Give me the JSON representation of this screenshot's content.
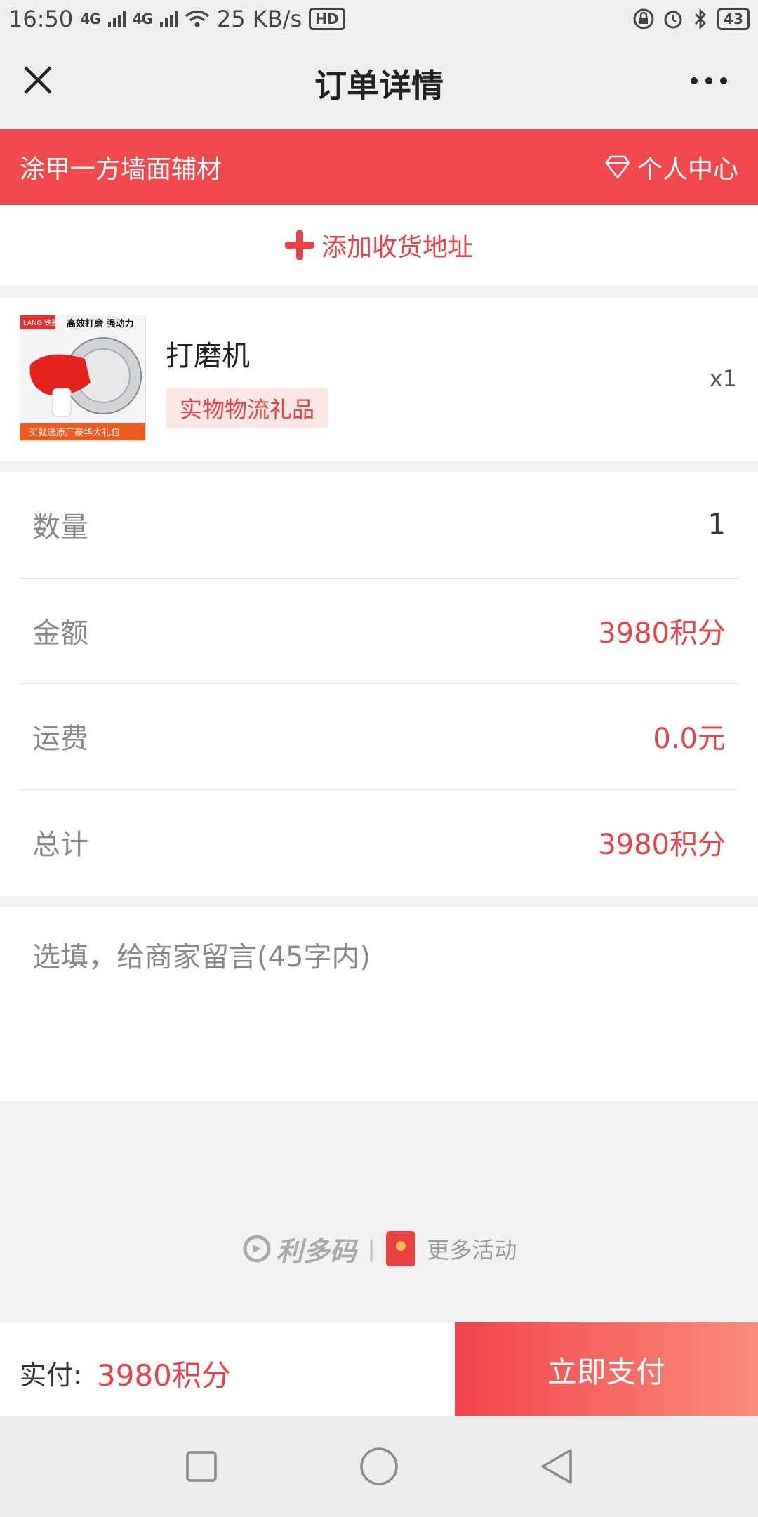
{
  "status_bar": {
    "time": "16:50",
    "network_1": "4G",
    "network_2": "4G",
    "speed": "25 KB/s",
    "hd": "HD",
    "battery": "43"
  },
  "header": {
    "title": "订单详情"
  },
  "shop_bar": {
    "shop_name": "涂甲一方墙面辅材",
    "user_center": "个人中心"
  },
  "address": {
    "label": "添加收货地址"
  },
  "product": {
    "name": "打磨机",
    "tag": "实物物流礼品",
    "quantity": "x1",
    "image_text_top": "高效打磨 强动力",
    "image_brand": "LANG 铁墨",
    "image_text_bottom": "买就送原厂豪华大礼包"
  },
  "details": [
    {
      "label": "数量",
      "value": "1"
    },
    {
      "label": "金额",
      "value": "3980积分"
    },
    {
      "label": "运费",
      "value": "0.0元"
    },
    {
      "label": "总计",
      "value": "3980积分"
    }
  ],
  "message": {
    "placeholder": "选填，给商家留言(45字内)"
  },
  "footer_brand": {
    "logo_text": "利多码",
    "separator": "|",
    "more_activity": "更多活动"
  },
  "pay_bar": {
    "paid_label": "实付:",
    "paid_amount": "3980积分",
    "pay_button": "立即支付"
  },
  "colors": {
    "accent": "#f2494f",
    "text_red": "#e84348",
    "tag_bg": "#fde7e7"
  }
}
